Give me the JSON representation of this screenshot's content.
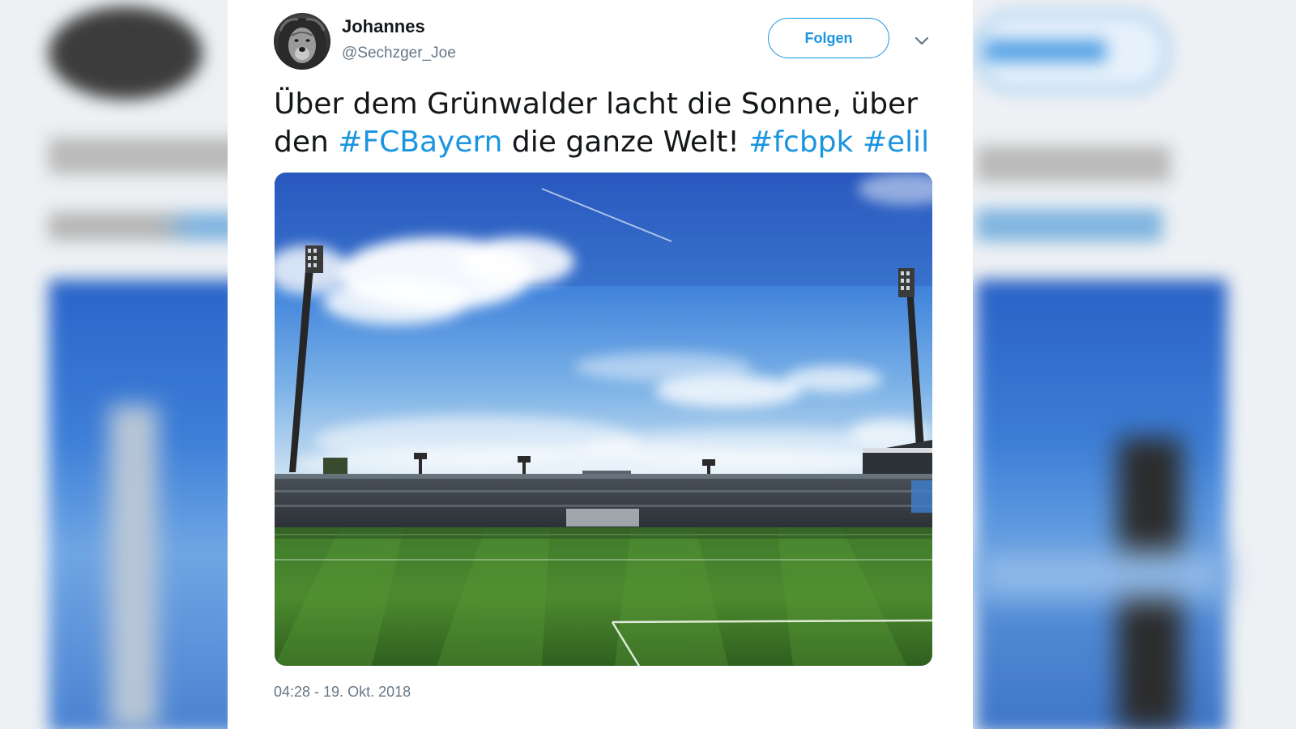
{
  "tweet": {
    "author_name": "Johannes",
    "author_handle": "@Sechzger_Joe",
    "follow_label": "Folgen",
    "text_parts": {
      "p1": "Über dem Grünwalder lacht die Sonne, über den ",
      "h1": "#FCBayern",
      "p2": " die ganze Welt! ",
      "h2": "#fcbpk",
      "p3": " ",
      "h3": "#elil"
    },
    "timestamp": "04:28 - 19. Okt. 2018"
  },
  "colors": {
    "link": "#1b95e0",
    "text": "#14171a",
    "secondary": "#657786"
  },
  "icons": {
    "more": "chevron-down-icon",
    "avatar": "lion-avatar"
  }
}
